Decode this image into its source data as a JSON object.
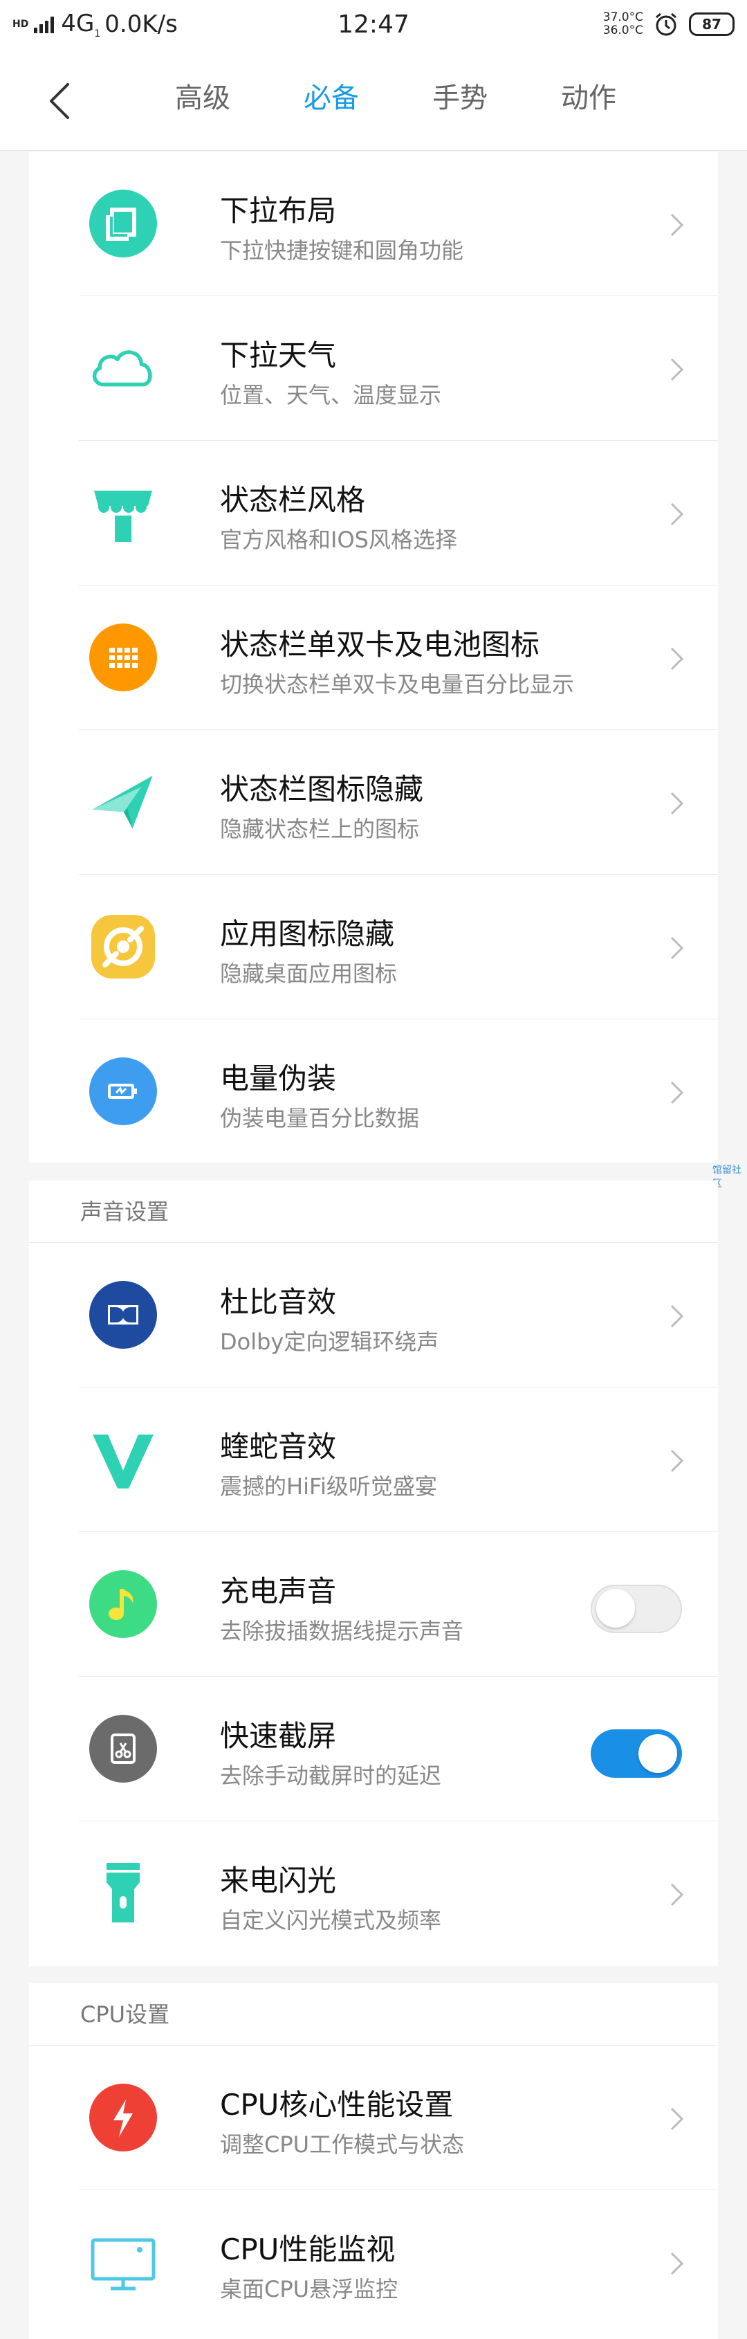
{
  "status_bar": {
    "hd": "HD",
    "network": "4G",
    "network_sub": "1",
    "speed": "0.0K/s",
    "time": "12:47",
    "temp_top": "37.0°C",
    "temp_bottom": "36.0°C",
    "battery": "87"
  },
  "nav": {
    "tabs": [
      {
        "label": "高级",
        "active": false
      },
      {
        "label": "必备",
        "active": true
      },
      {
        "label": "手势",
        "active": false
      },
      {
        "label": "动作",
        "active": false
      }
    ]
  },
  "colors": {
    "accent": "#1a9be6",
    "teal": "#2ed1b4",
    "orange": "#ff9800",
    "yellow": "#f6c63c",
    "blue": "#3f9df0",
    "navy": "#1e4aa0",
    "green": "#3ddc84",
    "gray": "#6b6b6b",
    "red": "#ef4036",
    "cyan": "#4ec8e6"
  },
  "card1": {
    "items": [
      {
        "title": "下拉布局",
        "subtitle": "下拉快捷按键和圆角功能",
        "icon": "layout-icon"
      },
      {
        "title": "下拉天气",
        "subtitle": "位置、天气、温度显示",
        "icon": "cloud-icon"
      },
      {
        "title": "状态栏风格",
        "subtitle": "官方风格和IOS风格选择",
        "icon": "shop-awning-icon"
      },
      {
        "title": "状态栏单双卡及电池图标",
        "subtitle": "切换状态栏单双卡及电量百分比显示",
        "icon": "grid-dots-icon"
      },
      {
        "title": "状态栏图标隐藏",
        "subtitle": "隐藏状态栏上的图标",
        "icon": "paper-plane-icon"
      },
      {
        "title": "应用图标隐藏",
        "subtitle": "隐藏桌面应用图标",
        "icon": "app-hide-icon"
      },
      {
        "title": "电量伪装",
        "subtitle": "伪装电量百分比数据",
        "icon": "battery-icon"
      }
    ]
  },
  "watermark": "馆留社区",
  "card2": {
    "section_title": "声音设置",
    "items": [
      {
        "title": "杜比音效",
        "subtitle": "Dolby定向逻辑环绕声",
        "icon": "dolby-icon"
      },
      {
        "title": "蝰蛇音效",
        "subtitle": "震撼的HiFi级听觉盛宴",
        "icon": "viper-icon"
      },
      {
        "title": "充电声音",
        "subtitle": "去除拔插数据线提示声音",
        "icon": "music-note-icon",
        "toggle": "off"
      },
      {
        "title": "快速截屏",
        "subtitle": "去除手动截屏时的延迟",
        "icon": "screenshot-icon",
        "toggle": "on"
      },
      {
        "title": "来电闪光",
        "subtitle": "自定义闪光模式及频率",
        "icon": "flashlight-icon"
      }
    ]
  },
  "card3": {
    "section_title": "CPU设置",
    "items": [
      {
        "title": "CPU核心性能设置",
        "subtitle": "调整CPU工作模式与状态",
        "icon": "lightning-icon"
      },
      {
        "title": "CPU性能监视",
        "subtitle": "桌面CPU悬浮监控",
        "icon": "monitor-icon"
      }
    ]
  }
}
